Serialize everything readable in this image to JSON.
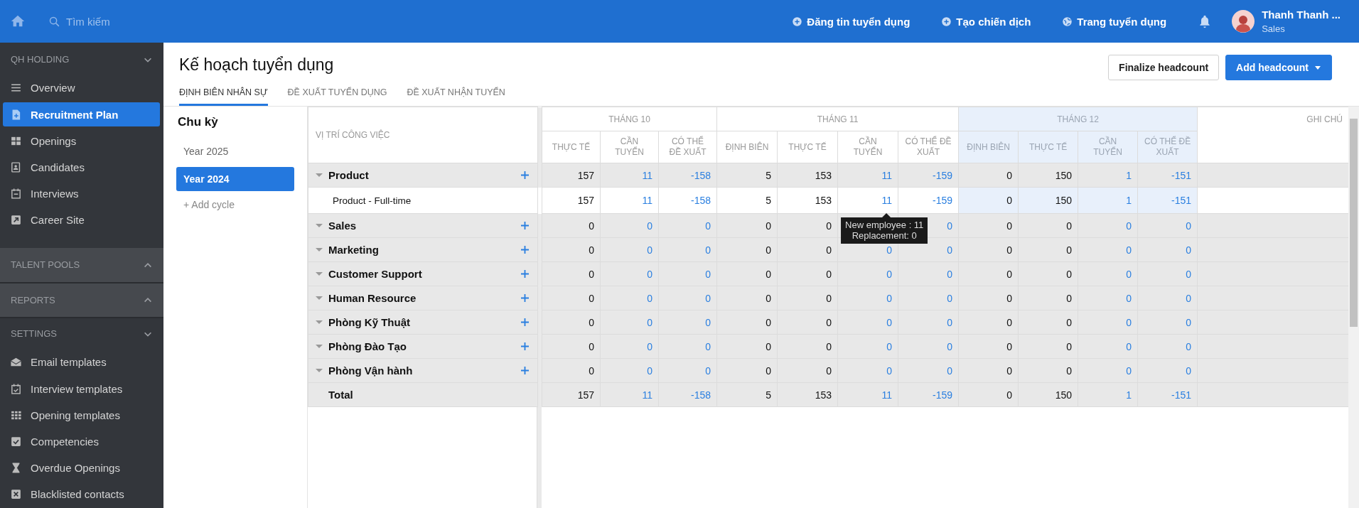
{
  "topbar": {
    "search": {
      "placeholder": "Tìm kiếm"
    },
    "actions": [
      {
        "label": "Đăng tin tuyển dụng"
      },
      {
        "label": "Tạo chiến dịch"
      },
      {
        "label": "Trang tuyển dụng"
      }
    ],
    "user": {
      "name": "Thanh Thanh ...",
      "role": "Sales"
    }
  },
  "sidebar": {
    "sections": [
      {
        "title": "QH HOLDING",
        "expanded": true,
        "items": [
          {
            "label": "Overview",
            "selected": false
          },
          {
            "label": "Recruitment Plan",
            "selected": true
          },
          {
            "label": "Openings",
            "selected": false
          },
          {
            "label": "Candidates",
            "selected": false
          },
          {
            "label": "Interviews",
            "selected": false
          },
          {
            "label": "Career Site",
            "selected": false
          }
        ]
      },
      {
        "title": "TALENT POOLS",
        "expanded": false
      },
      {
        "title": "REPORTS",
        "expanded": false
      },
      {
        "title": "SETTINGS",
        "expanded": true,
        "items": [
          {
            "label": "Email templates",
            "selected": false
          },
          {
            "label": "Interview templates",
            "selected": false
          },
          {
            "label": "Opening templates",
            "selected": false
          },
          {
            "label": "Competencies",
            "selected": false
          },
          {
            "label": "Overdue Openings",
            "selected": false
          },
          {
            "label": "Blacklisted contacts",
            "selected": false
          }
        ]
      }
    ]
  },
  "page": {
    "title": "Kế hoạch tuyển dụng",
    "tabs": [
      {
        "label": "ĐỊNH BIÊN NHÂN SỰ",
        "selected": true
      },
      {
        "label": "ĐỀ XUẤT TUYỂN DỤNG",
        "selected": false
      },
      {
        "label": "ĐỀ XUẤT NHẬN TUYỂN",
        "selected": false
      }
    ],
    "buttons": [
      {
        "label": "Finalize headcount",
        "kind": "secondary"
      },
      {
        "label": "Add headcount",
        "kind": "primary"
      }
    ]
  },
  "cycles": {
    "title": "Chu kỳ",
    "items": [
      {
        "label": "Year 2025",
        "selected": false
      },
      {
        "label": "Year 2024",
        "selected": true
      }
    ],
    "add_label": "+ Add cycle"
  },
  "table": {
    "position_header": "VỊ TRÍ CÔNG VIỆC",
    "note_header": "GHI CHÚ",
    "months": [
      {
        "label": "THÁNG 10",
        "selected": false,
        "columns": [
          {
            "label": "THỰC TẾ",
            "kind": "actual"
          },
          {
            "label": "CẦN TUYỂN",
            "kind": "needed"
          },
          {
            "label": "CÓ THỂ ĐỀ XUẤT",
            "kind": "proposable"
          }
        ]
      },
      {
        "label": "THÁNG 11",
        "selected": false,
        "columns": [
          {
            "label": "ĐỊNH BIÊN",
            "kind": "quota"
          },
          {
            "label": "THỰC TẾ",
            "kind": "actual"
          },
          {
            "label": "CẦN TUYỂN",
            "kind": "needed"
          },
          {
            "label": "CÓ THỂ ĐỀ XUẤT",
            "kind": "proposable"
          }
        ]
      },
      {
        "label": "THÁNG 12",
        "selected": true,
        "columns": [
          {
            "label": "ĐỊNH BIÊN",
            "kind": "quota"
          },
          {
            "label": "THỰC TẾ",
            "kind": "actual"
          },
          {
            "label": "CẦN TUYỂN",
            "kind": "needed"
          },
          {
            "label": "CÓ THỂ ĐỀ XUẤT",
            "kind": "proposable"
          }
        ]
      }
    ],
    "rows": [
      {
        "kind": "group",
        "name": "Product",
        "values": [
          "157",
          "11",
          "-158",
          "5",
          "153",
          "11",
          "-159",
          "0",
          "150",
          "1",
          "-151"
        ]
      },
      {
        "kind": "item",
        "name": "Product - Full-time",
        "values": [
          "157",
          "11",
          "-158",
          "5",
          "153",
          "11",
          "-159",
          "0",
          "150",
          "1",
          "-151"
        ],
        "tooltip": [
          "New employee : 11",
          "Replacement: 0"
        ]
      },
      {
        "kind": "group",
        "name": "Sales",
        "values": [
          "0",
          "0",
          "0",
          "0",
          "0",
          "0",
          "0",
          "0",
          "0",
          "0"
        ]
      },
      {
        "kind": "group",
        "name": "Marketing",
        "values": [
          "0",
          "0",
          "0",
          "0",
          "0",
          "0",
          "0",
          "0",
          "0",
          "0",
          "0"
        ]
      },
      {
        "kind": "group",
        "name": "Customer Support",
        "values": [
          "0",
          "0",
          "0",
          "0",
          "0",
          "0",
          "0",
          "0",
          "0",
          "0",
          "0"
        ]
      },
      {
        "kind": "group",
        "name": "Human Resource",
        "values": [
          "0",
          "0",
          "0",
          "0",
          "0",
          "0",
          "0",
          "0",
          "0",
          "0",
          "0"
        ]
      },
      {
        "kind": "group",
        "name": "Phòng Kỹ Thuật",
        "values": [
          "0",
          "0",
          "0",
          "0",
          "0",
          "0",
          "0",
          "0",
          "0",
          "0",
          "0"
        ]
      },
      {
        "kind": "group",
        "name": "Phòng Đào Tạo",
        "values": [
          "0",
          "0",
          "0",
          "0",
          "0",
          "0",
          "0",
          "0",
          "0",
          "0",
          "0"
        ]
      },
      {
        "kind": "group",
        "name": "Phòng Vận hành",
        "values": [
          "0",
          "0",
          "0",
          "0",
          "0",
          "0",
          "0",
          "0",
          "0",
          "0",
          "0"
        ]
      },
      {
        "kind": "total",
        "name": "Total",
        "values": [
          "157",
          "11",
          "-158",
          "5",
          "153",
          "11",
          "-159",
          "0",
          "150",
          "1",
          "-151"
        ]
      }
    ]
  }
}
